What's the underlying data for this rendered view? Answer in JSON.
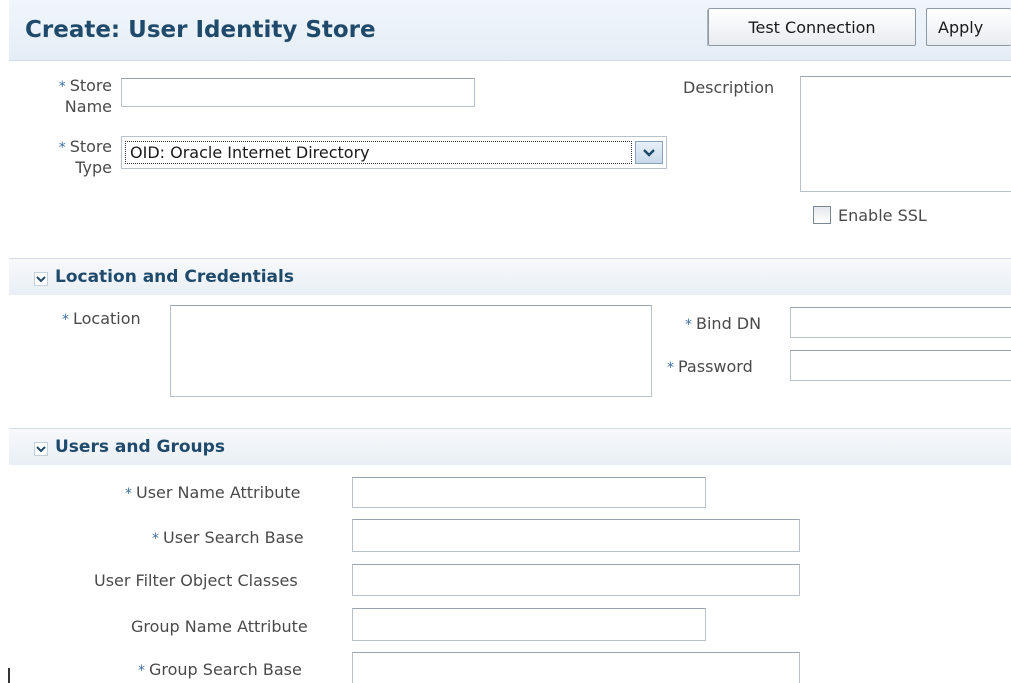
{
  "header": {
    "title": "Create: User Identity Store",
    "test_connection_label": "Test Connection",
    "apply_label": "Apply"
  },
  "store": {
    "required_mark": "*",
    "name_label_line1": "Store",
    "name_label_line2": "Name",
    "name_value": "",
    "type_label_line1": "Store",
    "type_label_line2": "Type",
    "type_selected": "OID: Oracle Internet Directory",
    "description_label": "Description",
    "description_value": "",
    "enable_ssl_label": "Enable SSL",
    "enable_ssl_checked": false
  },
  "location_section": {
    "title": "Location and Credentials",
    "location_label": "Location",
    "location_value": "",
    "bind_dn_label": "Bind DN",
    "bind_dn_value": "",
    "password_label": "Password",
    "password_value": ""
  },
  "users_section": {
    "title": "Users and Groups",
    "user_name_attribute_label": "User Name Attribute",
    "user_search_base_label": "User Search Base",
    "user_filter_object_classes_label": "User Filter Object Classes",
    "group_name_attribute_label": "Group Name Attribute",
    "group_search_base_label": "Group Search Base"
  },
  "icons": {
    "dropdown": "chevron-down-icon",
    "section_toggle": "chevron-down-icon"
  },
  "colors": {
    "title": "#1f4a6b",
    "required": "#3b6ea0",
    "label": "#4a4a4a"
  }
}
